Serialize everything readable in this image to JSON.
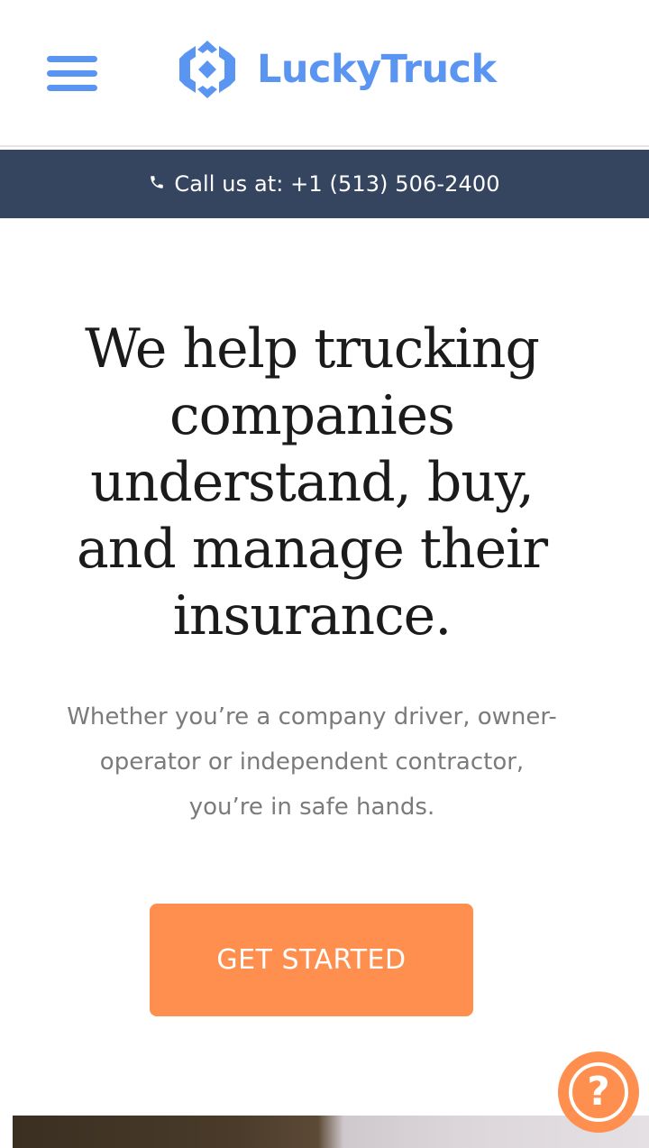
{
  "colors": {
    "brand": "#5b95f2",
    "call_bar": "#36455f",
    "cta": "#ff8f4e"
  },
  "header": {
    "menu_icon": "hamburger-menu-icon",
    "logo": {
      "icon": "luckytruck-logo-icon",
      "text": "LuckyTruck"
    }
  },
  "call_bar": {
    "icon": "phone-icon",
    "text": "Call us at: +1 (513) 506-2400"
  },
  "hero": {
    "title": "We help trucking companies understand, buy, and manage their insurance.",
    "subtitle": "Whether you’re a company driver, owner-operator or independent contractor, you’re in safe hands.",
    "cta_label": "GET STARTED"
  },
  "help_button": {
    "icon": "question-mark-icon",
    "glyph": "?"
  }
}
